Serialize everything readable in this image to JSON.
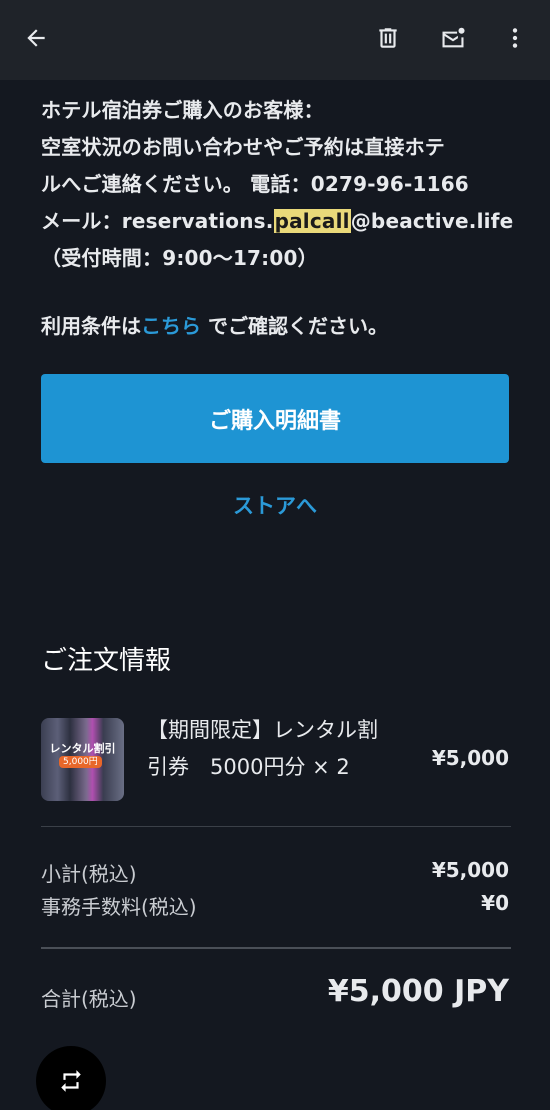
{
  "toolbar": {
    "back_icon": "arrow-left-icon",
    "delete_icon": "trash-icon",
    "mark_unread_icon": "mail-unread-icon",
    "more_icon": "more-vert-icon"
  },
  "notice": {
    "line1": "ホテル宿泊券ご購入のお客様：",
    "line2": "空室状況のお問い合わせやご予約は直接ホテ",
    "line3": "ルへご連絡ください。 電話：0279-96-1166",
    "line4_prefix": "メール：reservations.",
    "line4_highlight": "palcall",
    "line4_suffix": "@beactive.life",
    "line5": "（受付時間：9:00〜17:00）"
  },
  "terms": {
    "prefix": "利用条件は",
    "link": "こちら",
    "suffix": " でご確認ください。"
  },
  "buttons": {
    "receipt": "ご購入明細書",
    "store": "ストアへ"
  },
  "order": {
    "title": "ご注文情報",
    "item": {
      "thumb_label": "レンタル割引",
      "thumb_badge": "5,000円",
      "name_line1": "【期間限定】レンタル割",
      "name_line2": "引券　5000円分 × 2",
      "price": "¥5,000"
    },
    "subtotal_label": "小計(税込)",
    "subtotal_value": "¥5,000",
    "fee_label": "事務手数料(税込)",
    "fee_value": "¥0",
    "total_label": "合計(税込)",
    "total_value": "¥5,000 JPY"
  },
  "fab": {
    "icon": "repeat-icon"
  },
  "colors": {
    "background": "#141820",
    "toolbar": "#1f2329",
    "accent": "#1e94d3",
    "link": "#2b9ad8",
    "highlight": "#e9d97a"
  }
}
